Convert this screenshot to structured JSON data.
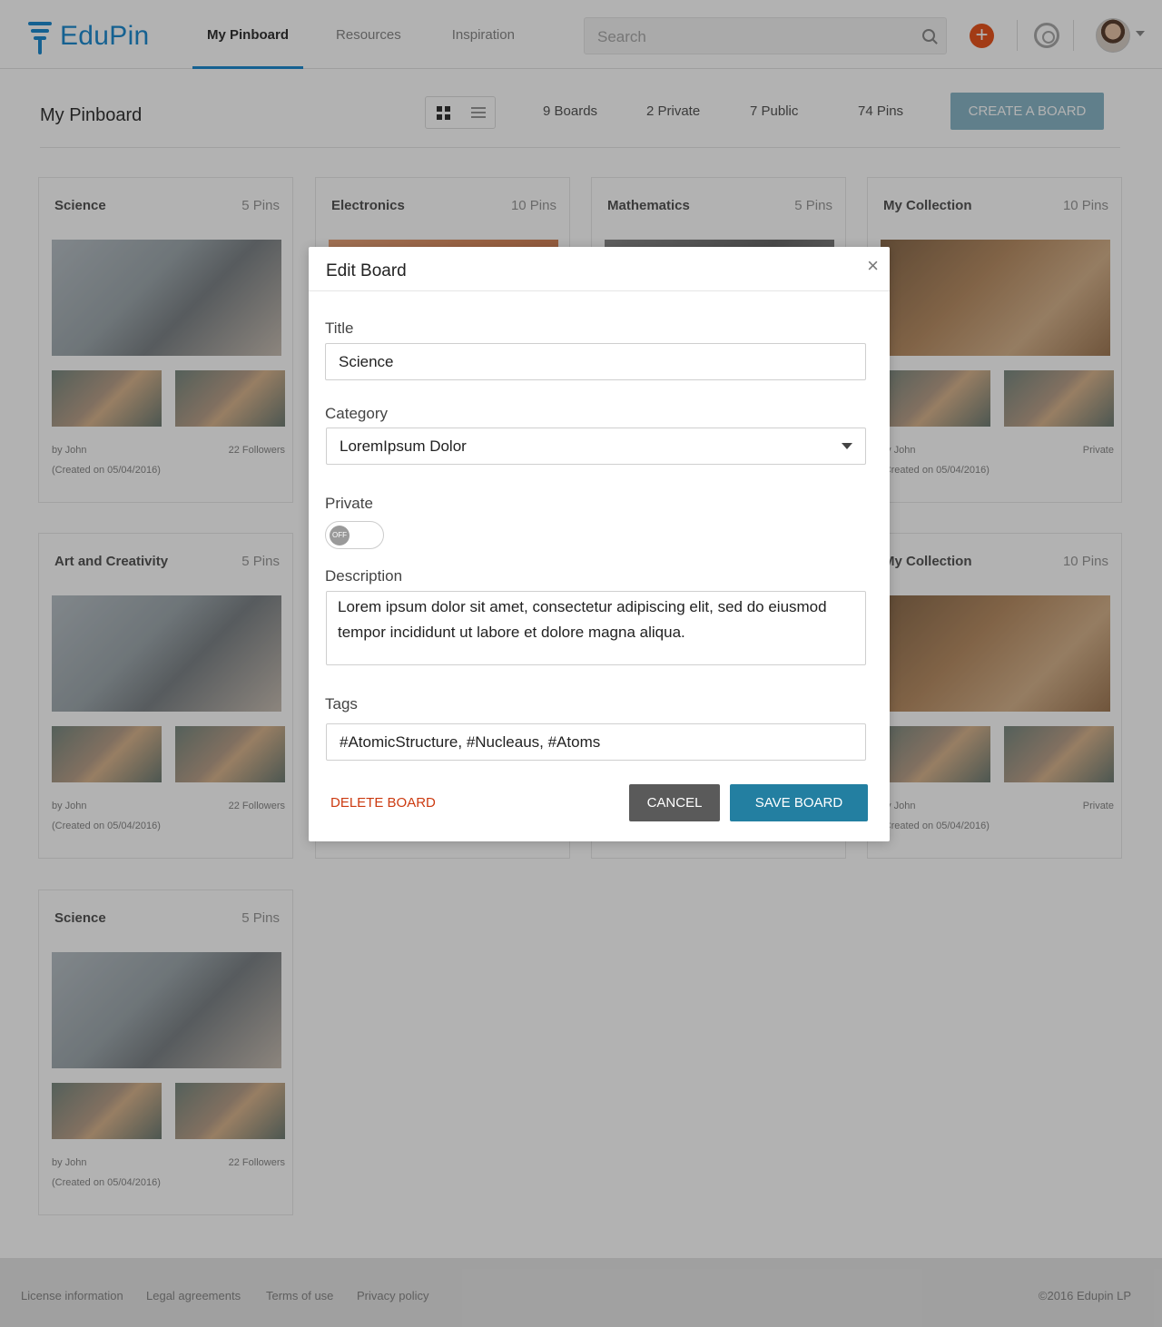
{
  "header": {
    "logo": "EduPin",
    "nav": [
      "My Pinboard",
      "Resources",
      "Inspiration"
    ],
    "search_placeholder": "Search",
    "add_label": "+"
  },
  "toolbar": {
    "title": "My Pinboard",
    "stats": [
      "9 Boards",
      "2 Private",
      "7 Public",
      "74 Pins"
    ],
    "create_label": "CREATE A BOARD"
  },
  "boards": [
    {
      "title": "Science",
      "pins": "5 Pins",
      "by": "by John",
      "created": "(Created on 05/04/2016)",
      "followers": "22 Followers"
    },
    {
      "title": "Electronics",
      "pins": "10 Pins",
      "by": "",
      "created": "",
      "followers": ""
    },
    {
      "title": "Mathematics",
      "pins": "5 Pins",
      "by": "",
      "created": "",
      "followers": ""
    },
    {
      "title": "My Collection",
      "pins": "10 Pins",
      "by": "by John",
      "created": "(Created on 05/04/2016)",
      "followers": "Private"
    },
    {
      "title": "Art and Creativity",
      "pins": "5 Pins",
      "by": "by John",
      "created": "(Created on 05/04/2016)",
      "followers": "22 Followers"
    },
    {
      "title": "My Collection",
      "pins": "10 Pins",
      "by": "by John",
      "created": "(Created on 05/04/2016)",
      "followers": "Private"
    },
    {
      "title": "Science",
      "pins": "5 Pins",
      "by": "by John",
      "created": "(Created on 05/04/2016)",
      "followers": "22 Followers"
    }
  ],
  "footer": {
    "links": [
      "License information",
      "Legal agreements",
      "Terms of use",
      "Privacy policy"
    ],
    "copyright": "©2016 Edupin LP"
  },
  "modal": {
    "title": "Edit Board",
    "close": "×",
    "title_label": "Title",
    "title_value": "Science",
    "category_label": "Category",
    "category_value": "LoremIpsum Dolor",
    "private_label": "Private",
    "private_state": "OFF",
    "description_label": "Description",
    "description_value": "Lorem ipsum dolor sit amet, consectetur adipiscing elit, sed do eiusmod tempor incididunt ut labore et dolore magna aliqua.",
    "tags_label": "Tags",
    "tags_value": "#AtomicStructure, #Nucleaus, #Atoms",
    "delete_label": "DELETE BOARD",
    "cancel_label": "CANCEL",
    "save_label": "SAVE BOARD"
  },
  "colors": {
    "brand": "#1f8bd0",
    "save": "#237fa1",
    "cancel": "#5a5a5a",
    "delete": "#cc3a10",
    "add": "#e8551f"
  }
}
